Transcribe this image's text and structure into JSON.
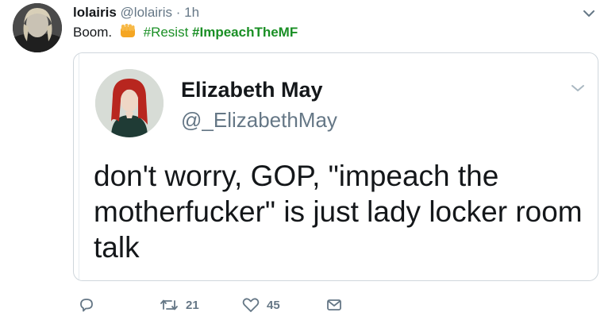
{
  "tweet": {
    "display_name": "lolairis",
    "handle": "@lolairis",
    "separator": "·",
    "time": "1h",
    "text_before": "Boom.",
    "hashtag_1": "#Resist",
    "hashtag_2": "#ImpeachTheMF"
  },
  "quoted_tweet": {
    "display_name": "Elizabeth May",
    "handle": "@_ElizabethMay",
    "text": "don't worry, GOP, \"impeach the motherfucker\" is just lady locker room talk"
  },
  "actions": {
    "reply_count": "",
    "retweet_count": "21",
    "like_count": "45"
  },
  "colors": {
    "hashtag": "#1a8f25",
    "muted": "#657786",
    "border": "#cfd6dc",
    "emoji_fist": "#f5a623"
  },
  "icons": [
    "chevron-down-icon",
    "fist-bump-emoji",
    "reply-icon",
    "retweet-icon",
    "heart-icon",
    "message-icon"
  ]
}
